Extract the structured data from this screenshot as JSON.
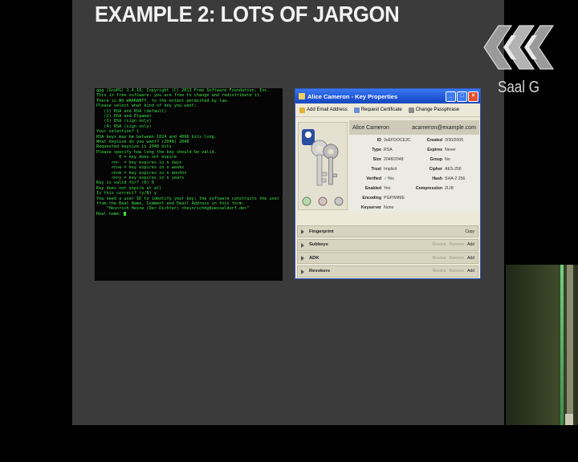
{
  "slide": {
    "title": "EXAMPLE 2:  LOTS OF JARGON"
  },
  "branding": {
    "room_label": "Saal G",
    "logo_icon": "ccc-logo-icon"
  },
  "terminal": {
    "lines": [
      "gpg (GnuPG) 1.4.16; Copyright (C) 2013 Free Software Foundation, Inc.",
      "This is free software: you are free to change and redistribute it.",
      "There is NO WARRANTY, to the extent permitted by law.",
      "",
      "Please select what kind of key you want:",
      "   (1) RSA and RSA (default)",
      "   (2) DSA and Elgamal",
      "   (3) DSA (sign only)",
      "   (4) RSA (sign only)",
      "Your selection? 1",
      "RSA keys may be between 1024 and 4096 bits long.",
      "What keysize do you want? (2048) 2048",
      "Requested keysize is 2048 bits",
      "Please specify how long the key should be valid.",
      "         0 = key does not expire",
      "      <n>  = key expires in n days",
      "      <n>w = key expires in n weeks",
      "      <n>m = key expires in n months",
      "      <n>y = key expires in n years",
      "Key is valid for? (0) 0",
      "Key does not expire at all",
      "Is this correct? (y/N) y",
      "",
      "You need a user ID to identify your key; the software constructs the user ID",
      "from the Real Name, Comment and Email Address in this form:",
      "    \"Heinrich Heine (Der Dichter) <heinrichh@duesseldorf.de>\"",
      "",
      "Real name: "
    ],
    "colors": {
      "text": "#3fe04a",
      "background": "#050505"
    }
  },
  "dialog": {
    "title": "Alice Cameron - Key Properties",
    "toolbar": {
      "add_email": "Add Email Address",
      "request_certificate": "Request Certificate",
      "change_passphrase": "Change Passphrase"
    },
    "header": {
      "name": "Alice Cameron",
      "email": "acameron@example.com"
    },
    "props_left": [
      {
        "label": "ID",
        "value": "0xEFDOCE3C"
      },
      {
        "label": "Type",
        "value": "RSA"
      },
      {
        "label": "Size",
        "value": "2048/2048"
      },
      {
        "label": "Trust",
        "value": "Implicit"
      },
      {
        "label": "Verified",
        "value": "Yes"
      },
      {
        "label": "Enabled",
        "value": "Yes"
      },
      {
        "label": "Encoding",
        "value": "PGP/MIME"
      },
      {
        "label": "Keyserver",
        "value": "None"
      }
    ],
    "props_right": [
      {
        "label": "Created",
        "value": "3/30/2005"
      },
      {
        "label": "Expires",
        "value": "Never"
      },
      {
        "label": "Group",
        "value": "No"
      },
      {
        "label": "Cipher",
        "value": "AES-256"
      },
      {
        "label": "Hash",
        "value": "SHA-2 256"
      },
      {
        "label": "Compression",
        "value": "ZLIB"
      }
    ],
    "sections": [
      {
        "label": "Fingerprint",
        "actions": [
          "Copy"
        ]
      },
      {
        "label": "Subkeys",
        "actions": [
          "Revoke",
          "Remove",
          "Add"
        ]
      },
      {
        "label": "ADK",
        "actions": [
          "Revoke",
          "Remove",
          "Add"
        ]
      },
      {
        "label": "Revokers",
        "actions": [
          "Revoke",
          "Remove",
          "Add"
        ]
      }
    ],
    "colors": {
      "titlebar": "#1f56d8",
      "body": "#ece9d8"
    }
  }
}
